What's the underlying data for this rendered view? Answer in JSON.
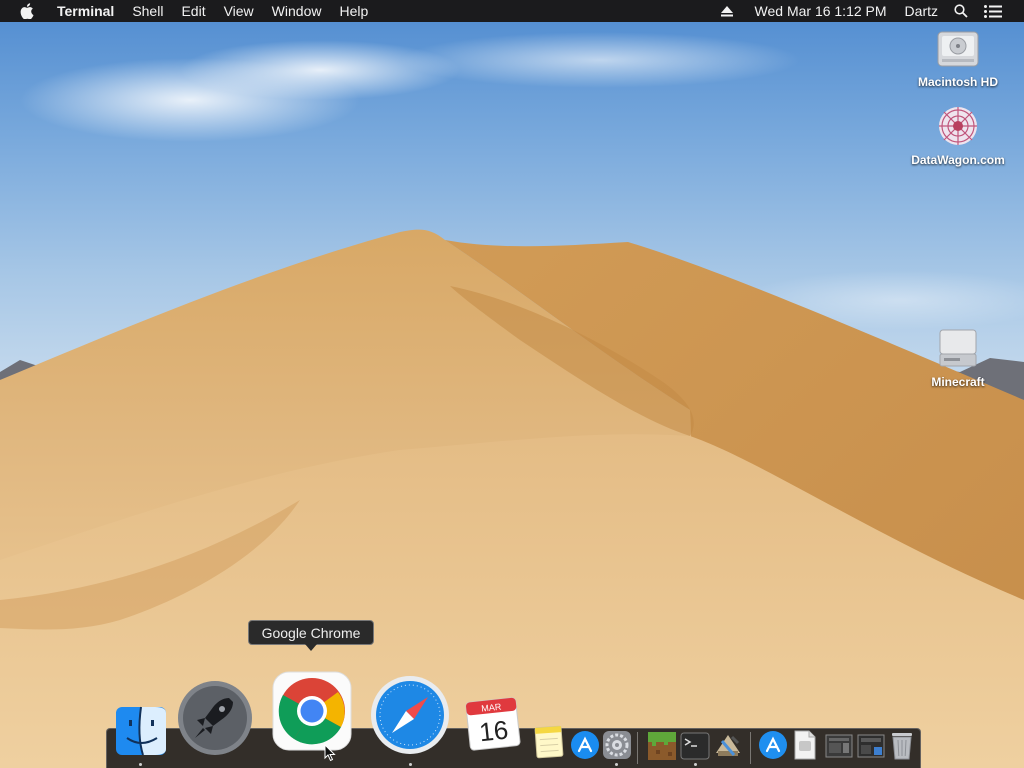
{
  "menubar": {
    "app_name": "Terminal",
    "menus": [
      "Shell",
      "Edit",
      "View",
      "Window",
      "Help"
    ],
    "clock": "Wed Mar 16  1:12 PM",
    "user": "Dartz",
    "icons": [
      "apple-icon",
      "eject-icon",
      "spotlight-search-icon",
      "notification-center-icon"
    ]
  },
  "desktop": {
    "icons": [
      {
        "label": "Macintosh HD",
        "icon": "hard-drive-icon"
      },
      {
        "label": "DataWagon.com",
        "icon": "datawagon-volume-icon"
      },
      {
        "label": "Minecraft",
        "icon": "disk-image-icon"
      }
    ]
  },
  "tooltip": {
    "text": "Google Chrome"
  },
  "dock": {
    "items": [
      "finder-icon",
      "launchpad-icon",
      "google-chrome-icon",
      "safari-icon",
      "calendar-icon",
      "notes-icon",
      "app-store-icon",
      "system-preferences-icon",
      "minecraft-icon",
      "terminal-icon",
      "xcode-icon",
      "app-store-folder-icon",
      "document-icon",
      "screenshot-stack-icon",
      "screenshot-stack-icon",
      "trash-icon"
    ],
    "calendar": {
      "month": "MAR",
      "day": "16"
    }
  },
  "colors": {
    "menubar": "#1b1b1d",
    "sky": "#79a9dc",
    "sand": "#d9a96a",
    "dock": "#141416"
  }
}
